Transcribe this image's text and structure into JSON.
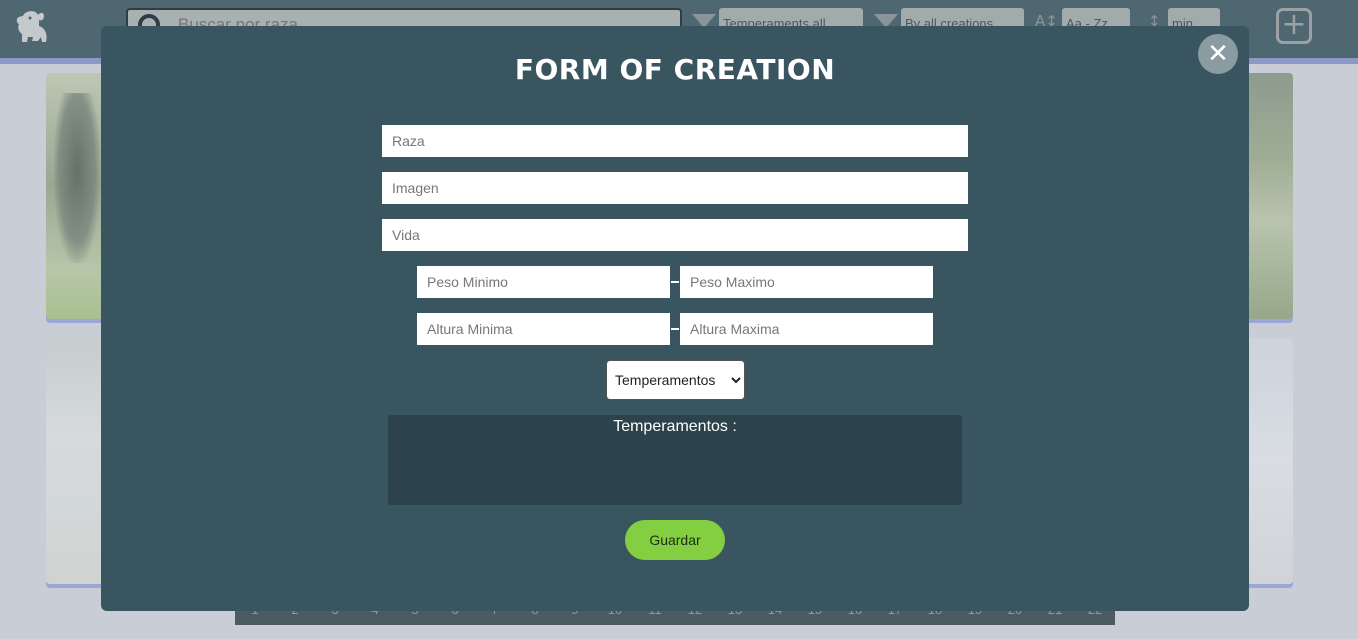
{
  "search": {
    "placeholder": "Buscar por raza"
  },
  "filters": {
    "temperament_value": "Temperaments all",
    "creation_value": "By all creations",
    "alpha_value": "Aa - Zz",
    "weight_value": "min"
  },
  "pagination": {
    "pages": [
      "1",
      "2",
      "3",
      "4",
      "5",
      "6",
      "7",
      "8",
      "9",
      "10",
      "11",
      "12",
      "13",
      "14",
      "15",
      "16",
      "17",
      "18",
      "19",
      "20",
      "21",
      "22"
    ]
  },
  "modal": {
    "title": "FORM OF CREATION",
    "close_label": "✕",
    "fields": {
      "raza": "Raza",
      "imagen": "Imagen",
      "vida": "Vida",
      "peso_min": "Peso Minimo",
      "peso_max": "Peso Maximo",
      "altura_min": "Altura Minima",
      "altura_max": "Altura Maxima"
    },
    "temperament_select": "Temperamentos",
    "temperaments_label": "Temperamentos :",
    "save_label": "Guardar"
  },
  "colors": {
    "modal_bg": "#385560",
    "save_button": "#84cf41",
    "topbar": "#4f6770"
  },
  "icons": [
    "dog-logo-icon",
    "search-icon",
    "filter-icon",
    "sort-alpha-icon",
    "sort-weight-icon",
    "add-icon",
    "close-icon"
  ]
}
